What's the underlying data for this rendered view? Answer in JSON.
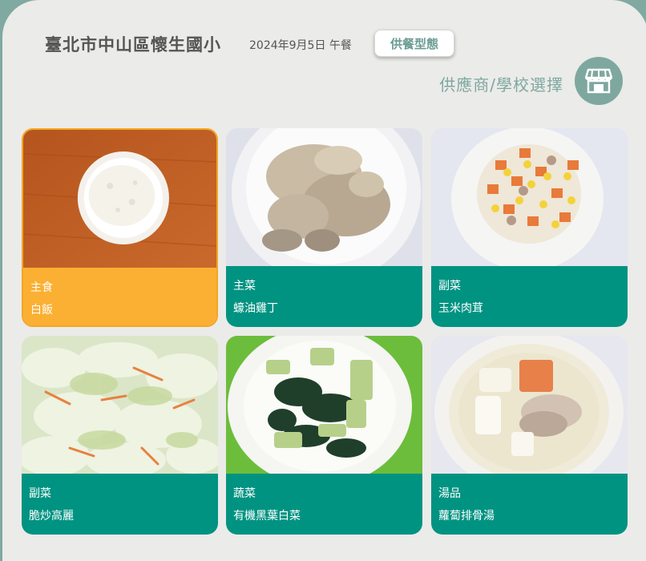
{
  "header": {
    "school_name": "臺北市中山區懷生國小",
    "date_meal": "2024年9月5日 午餐",
    "meal_type_button": "供餐型態",
    "supplier_label": "供應商/學校選擇"
  },
  "icons": {
    "store": "store-icon"
  },
  "colors": {
    "teal": "#009382",
    "orange": "#fbb033",
    "accent_gray_green": "#7ea89f"
  },
  "dishes": [
    {
      "category": "主食",
      "name": "白飯"
    },
    {
      "category": "主菜",
      "name": "蠔油雞丁"
    },
    {
      "category": "副菜",
      "name": "玉米肉茸"
    },
    {
      "category": "副菜",
      "name": "脆炒高麗"
    },
    {
      "category": "蔬菜",
      "name": "有機黑葉白菜"
    },
    {
      "category": "湯品",
      "name": "蘿蔔排骨湯"
    }
  ]
}
